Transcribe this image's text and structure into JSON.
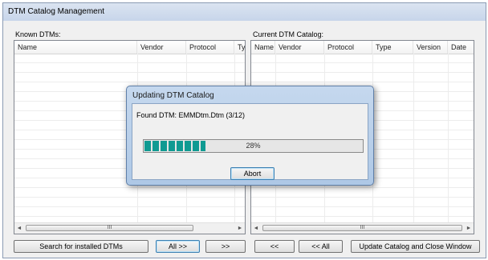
{
  "window": {
    "title": "DTM Catalog Management"
  },
  "known": {
    "label": "Known DTMs:",
    "columns": [
      "Name",
      "Vendor",
      "Protocol",
      "Type"
    ]
  },
  "current": {
    "label": "Current DTM Catalog:",
    "columns": [
      "Name",
      "Vendor",
      "Protocol",
      "Type",
      "Version",
      "Date"
    ]
  },
  "scroll": {
    "left_arrow": "◄",
    "right_arrow": "►",
    "grip": "III"
  },
  "buttons": {
    "search": "Search for installed DTMs",
    "all_right": "All >>",
    "right": ">>",
    "left": "<<",
    "all_left": "<< All",
    "update": "Update Catalog and Close Window"
  },
  "dialog": {
    "title": "Updating DTM Catalog",
    "message": "Found DTM: EMMDtm.Dtm (3/12)",
    "progress_percent": 28,
    "progress_label": "28%",
    "abort": "Abort"
  },
  "colors": {
    "progress": "#0f9a92",
    "title_bar": "#c7d5ea"
  }
}
